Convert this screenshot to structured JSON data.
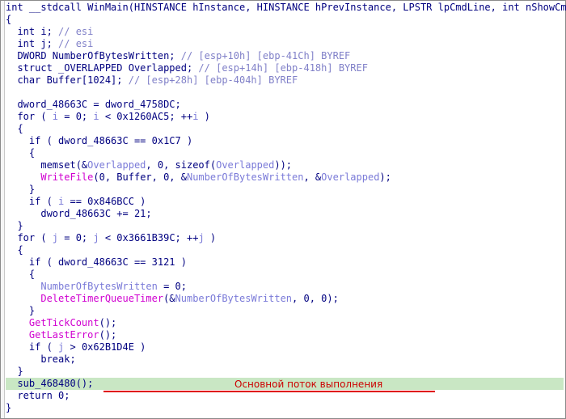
{
  "lines": [
    {
      "segments": [
        {
          "t": "int __stdcall WinMain(HINSTANCE hInstance, HINSTANCE hPrevInstance, LPSTR lpCmdLine, int nShowCmd)",
          "c": "kw"
        }
      ],
      "style": "first"
    },
    {
      "segments": [
        {
          "t": "{",
          "c": "kw"
        }
      ]
    },
    {
      "segments": [
        {
          "t": "  int i; ",
          "c": "kw"
        },
        {
          "t": "// esi",
          "c": "cm"
        }
      ]
    },
    {
      "segments": [
        {
          "t": "  int j; ",
          "c": "kw"
        },
        {
          "t": "// esi",
          "c": "cm"
        }
      ]
    },
    {
      "segments": [
        {
          "t": "  DWORD NumberOfBytesWritten; ",
          "c": "kw"
        },
        {
          "t": "// [esp+10h] [ebp-41Ch] BYREF",
          "c": "cm"
        }
      ]
    },
    {
      "segments": [
        {
          "t": "  struct _OVERLAPPED Overlapped; ",
          "c": "kw"
        },
        {
          "t": "// [esp+14h] [ebp-418h] BYREF",
          "c": "cm"
        }
      ]
    },
    {
      "segments": [
        {
          "t": "  char Buffer[1024]; ",
          "c": "kw"
        },
        {
          "t": "// [esp+28h] [ebp-404h] BYREF",
          "c": "cm"
        }
      ]
    },
    {
      "segments": [
        {
          "t": "",
          "c": "kw"
        }
      ]
    },
    {
      "segments": [
        {
          "t": "  dword_48663C = dword_4758DC;",
          "c": "kw"
        }
      ]
    },
    {
      "segments": [
        {
          "t": "  for ( ",
          "c": "kw"
        },
        {
          "t": "i",
          "c": "lv"
        },
        {
          "t": " = 0; ",
          "c": "kw"
        },
        {
          "t": "i",
          "c": "lv"
        },
        {
          "t": " < 0x1260AC5; ++",
          "c": "kw"
        },
        {
          "t": "i",
          "c": "lv"
        },
        {
          "t": " )",
          "c": "kw"
        }
      ]
    },
    {
      "segments": [
        {
          "t": "  {",
          "c": "kw"
        }
      ]
    },
    {
      "segments": [
        {
          "t": "    if ( dword_48663C == 0x1C7 )",
          "c": "kw"
        }
      ]
    },
    {
      "segments": [
        {
          "t": "    {",
          "c": "kw"
        }
      ]
    },
    {
      "segments": [
        {
          "t": "      memset(&",
          "c": "kw"
        },
        {
          "t": "Overlapped",
          "c": "lv"
        },
        {
          "t": ", 0, sizeof(",
          "c": "kw"
        },
        {
          "t": "Overlapped",
          "c": "lv"
        },
        {
          "t": "));",
          "c": "kw"
        }
      ]
    },
    {
      "segments": [
        {
          "t": "      ",
          "c": "kw"
        },
        {
          "t": "WriteFile",
          "c": "fn"
        },
        {
          "t": "(0, Buffer, 0, &",
          "c": "kw"
        },
        {
          "t": "NumberOfBytesWritten",
          "c": "lv"
        },
        {
          "t": ", &",
          "c": "kw"
        },
        {
          "t": "Overlapped",
          "c": "lv"
        },
        {
          "t": ");",
          "c": "kw"
        }
      ]
    },
    {
      "segments": [
        {
          "t": "    }",
          "c": "kw"
        }
      ]
    },
    {
      "segments": [
        {
          "t": "    if ( ",
          "c": "kw"
        },
        {
          "t": "i",
          "c": "lv"
        },
        {
          "t": " == 0x846BCC )",
          "c": "kw"
        }
      ]
    },
    {
      "segments": [
        {
          "t": "      dword_48663C += 21;",
          "c": "kw"
        }
      ]
    },
    {
      "segments": [
        {
          "t": "  }",
          "c": "kw"
        }
      ]
    },
    {
      "segments": [
        {
          "t": "  for ( ",
          "c": "kw"
        },
        {
          "t": "j",
          "c": "lv"
        },
        {
          "t": " = 0; ",
          "c": "kw"
        },
        {
          "t": "j",
          "c": "lv"
        },
        {
          "t": " < 0x3661B39C; ++",
          "c": "kw"
        },
        {
          "t": "j",
          "c": "lv"
        },
        {
          "t": " )",
          "c": "kw"
        }
      ]
    },
    {
      "segments": [
        {
          "t": "  {",
          "c": "kw"
        }
      ]
    },
    {
      "segments": [
        {
          "t": "    if ( dword_48663C == 3121 )",
          "c": "kw"
        }
      ]
    },
    {
      "segments": [
        {
          "t": "    {",
          "c": "kw"
        }
      ]
    },
    {
      "segments": [
        {
          "t": "      ",
          "c": "kw"
        },
        {
          "t": "NumberOfBytesWritten",
          "c": "lv"
        },
        {
          "t": " = 0;",
          "c": "kw"
        }
      ]
    },
    {
      "segments": [
        {
          "t": "      ",
          "c": "kw"
        },
        {
          "t": "DeleteTimerQueueTimer",
          "c": "fn"
        },
        {
          "t": "(&",
          "c": "kw"
        },
        {
          "t": "NumberOfBytesWritten",
          "c": "lv"
        },
        {
          "t": ", 0, 0);",
          "c": "kw"
        }
      ]
    },
    {
      "segments": [
        {
          "t": "    }",
          "c": "kw"
        }
      ]
    },
    {
      "segments": [
        {
          "t": "    ",
          "c": "kw"
        },
        {
          "t": "GetTickCount",
          "c": "fn"
        },
        {
          "t": "();",
          "c": "kw"
        }
      ]
    },
    {
      "segments": [
        {
          "t": "    ",
          "c": "kw"
        },
        {
          "t": "GetLastError",
          "c": "fn"
        },
        {
          "t": "();",
          "c": "kw"
        }
      ]
    },
    {
      "segments": [
        {
          "t": "    if ( ",
          "c": "kw"
        },
        {
          "t": "j",
          "c": "lv"
        },
        {
          "t": " > 0x62B1D4E )",
          "c": "kw"
        }
      ]
    },
    {
      "segments": [
        {
          "t": "      break;",
          "c": "kw"
        }
      ]
    },
    {
      "segments": [
        {
          "t": "  }",
          "c": "kw"
        }
      ]
    },
    {
      "segments": [
        {
          "t": "  sub_468480();",
          "c": "kw"
        }
      ],
      "style": "hl"
    },
    {
      "segments": [
        {
          "t": "  return 0;",
          "c": "kw"
        }
      ]
    },
    {
      "segments": [
        {
          "t": "}",
          "c": "kw"
        }
      ]
    }
  ],
  "annotation": {
    "text": "Основной поток выполнения",
    "color": "#cc0000"
  }
}
